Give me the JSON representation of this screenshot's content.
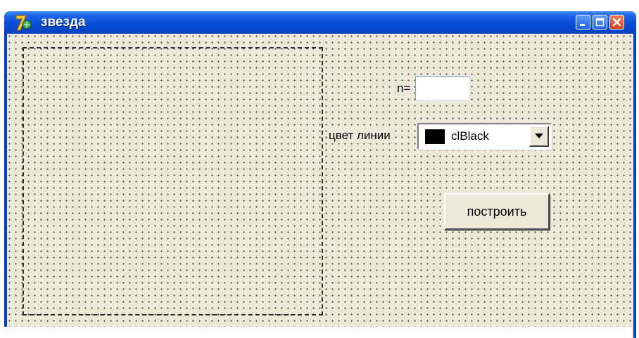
{
  "window": {
    "title": "звезда"
  },
  "form": {
    "n_label": "n=",
    "n_value": "",
    "color_label": "цвет линии",
    "color_select": {
      "selected": "clBlack",
      "swatch_color": "#000000"
    },
    "build_button": "построить"
  },
  "icons": [
    "app-icon",
    "minimize-icon",
    "maximize-icon",
    "close-icon",
    "dropdown-arrow-icon"
  ]
}
